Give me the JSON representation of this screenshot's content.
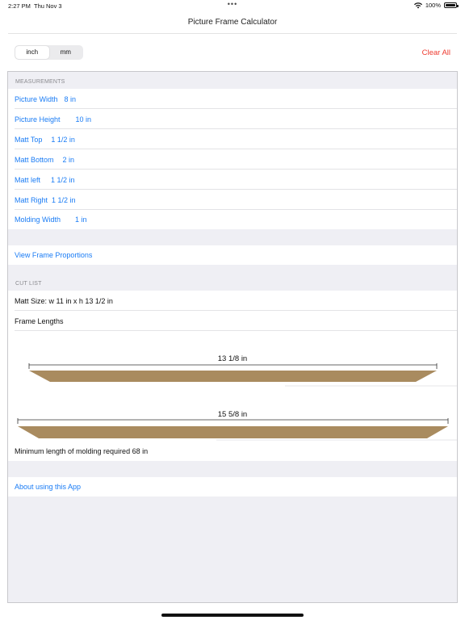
{
  "status_bar": {
    "time": "2:27 PM",
    "date": "Thu Nov 3",
    "dots": "•••",
    "battery_percent": "100%",
    "battery_level": 1.0
  },
  "nav": {
    "title": "Picture Frame Calculator"
  },
  "units": {
    "options": [
      "inch",
      "mm"
    ],
    "selected": "inch"
  },
  "clear_all_label": "Clear All",
  "measurements": {
    "header": "MEASUREMENTS",
    "items": [
      {
        "label": "Picture Width",
        "value": "8 in"
      },
      {
        "label": "Picture Height",
        "value": "10 in"
      },
      {
        "label": "Matt Top",
        "value": "1 1/2 in"
      },
      {
        "label": "Matt Bottom",
        "value": "2 in"
      },
      {
        "label": "Matt left",
        "value": "1 1/2 in"
      },
      {
        "label": "Matt Right",
        "value": "1 1/2 in"
      },
      {
        "label": "Molding Width",
        "value": "1 in"
      }
    ]
  },
  "view_proportions_label": "View Frame Proportions",
  "cut_list": {
    "header": "CUT LIST",
    "matt_size": "Matt Size: w 11 in x h 13 1/2 in",
    "frame_lengths_label": "Frame Lengths",
    "pieces": [
      {
        "length_label": "13 1/8 in"
      },
      {
        "length_label": "15 5/8 in"
      }
    ],
    "minimum_length": "Minimum length of molding required  68 in"
  },
  "about_label": "About using this App",
  "colors": {
    "link": "#1a7cf5",
    "destructive": "#ee3b30",
    "molding": "#a98b5f",
    "grouped_bg": "#efeff4"
  }
}
